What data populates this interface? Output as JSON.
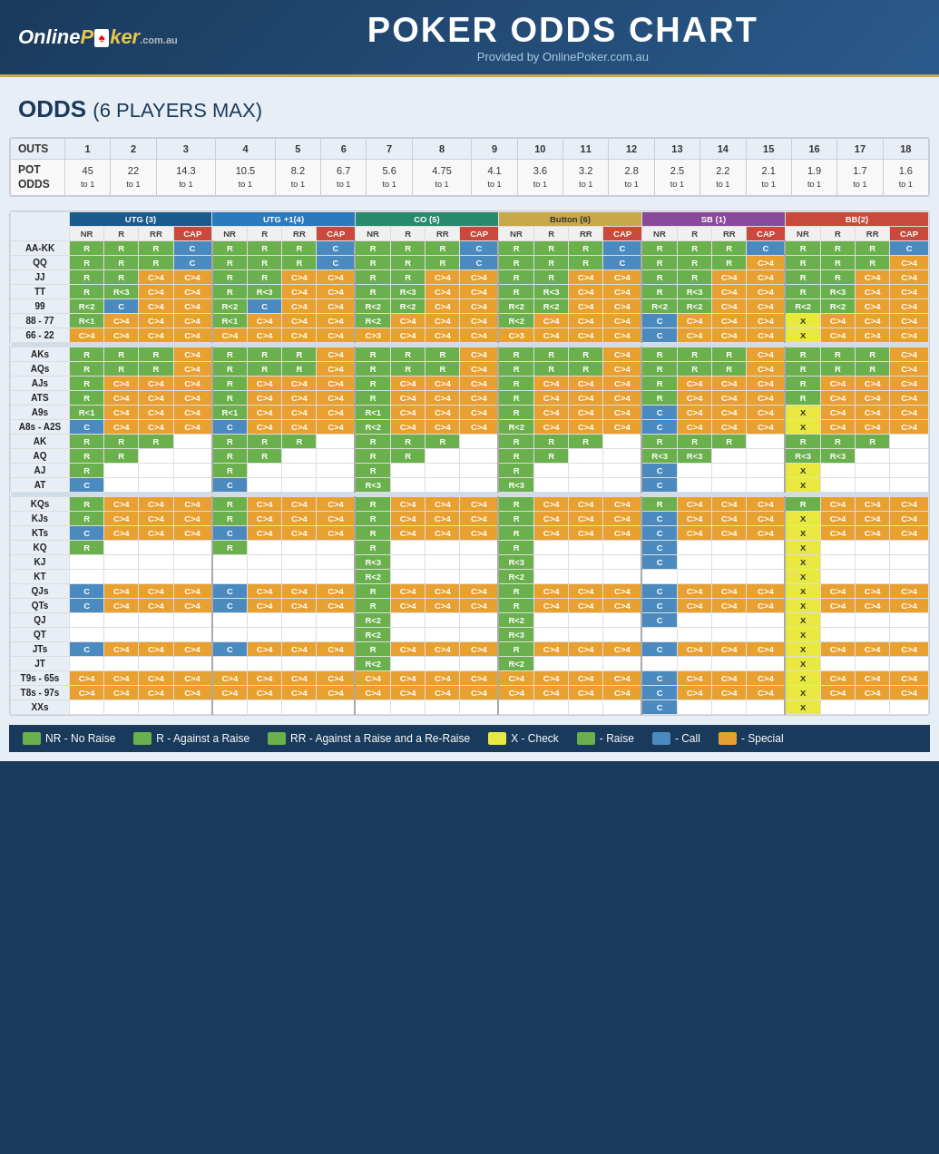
{
  "header": {
    "logo": "OnlinePoker.com.au",
    "title": "POKER ODDS CHART",
    "subtitle": "Provided by OnlinePoker.com.au"
  },
  "section_title": "ODDS",
  "section_subtitle": "(6 PLAYERS MAX)",
  "outs_row": {
    "label": "OUTS",
    "values": [
      "1",
      "2",
      "3",
      "4",
      "5",
      "6",
      "7",
      "8",
      "9",
      "10",
      "11",
      "12",
      "13",
      "14",
      "15",
      "16",
      "17",
      "18"
    ]
  },
  "pot_odds_row": {
    "label1": "POT",
    "label2": "ODDS",
    "values": [
      {
        "top": "45",
        "bot": "to 1"
      },
      {
        "top": "22",
        "bot": "to 1"
      },
      {
        "top": "14.3",
        "bot": "to 1"
      },
      {
        "top": "10.5",
        "bot": "to 1"
      },
      {
        "top": "8.2",
        "bot": "to 1"
      },
      {
        "top": "6.7",
        "bot": "to 1"
      },
      {
        "top": "5.6",
        "bot": "to 1"
      },
      {
        "top": "4.75",
        "bot": "to 1"
      },
      {
        "top": "4.1",
        "bot": "to 1"
      },
      {
        "top": "3.6",
        "bot": "to 1"
      },
      {
        "top": "3.2",
        "bot": "to 1"
      },
      {
        "top": "2.8",
        "bot": "to 1"
      },
      {
        "top": "2.5",
        "bot": "to 1"
      },
      {
        "top": "2.2",
        "bot": "to 1"
      },
      {
        "top": "2.1",
        "bot": "to 1"
      },
      {
        "top": "1.9",
        "bot": "to 1"
      },
      {
        "top": "1.7",
        "bot": "to 1"
      },
      {
        "top": "1.6",
        "bot": "to 1"
      }
    ]
  },
  "positions": [
    {
      "name": "UTG (3)",
      "key": "utg"
    },
    {
      "name": "UTG +1(4)",
      "key": "utg1"
    },
    {
      "name": "CO (5)",
      "key": "co"
    },
    {
      "name": "Button (6)",
      "key": "btn"
    },
    {
      "name": "SB (1)",
      "key": "sb"
    },
    {
      "name": "BB(2)",
      "key": "bb"
    }
  ],
  "sub_headers": [
    "NR",
    "R",
    "RR",
    "CAP"
  ],
  "legend": {
    "nr": "NR - No Raise",
    "r": "R - Against a Raise",
    "rr": "RR - Against a Raise and a Re-Raise",
    "x": "X - Check",
    "raise_label": "- Raise",
    "call_label": "- Call",
    "special_label": "- Special",
    "colors": {
      "nr_bg": "#6ab04c",
      "r_bg": "#6ab04c",
      "rr_bg": "#6ab04c",
      "call_bg": "#4a8abf",
      "x_bg": "#e8e840",
      "raise_bg": "#6ab04c",
      "special_bg": "#e8a030"
    }
  },
  "hands": [
    {
      "hand": "AA-KK",
      "rows": [
        [
          "R",
          "R",
          "R",
          "C",
          "R",
          "R",
          "R",
          "C",
          "R",
          "R",
          "R",
          "C",
          "R",
          "R",
          "R",
          "C",
          "R",
          "R",
          "R",
          "C",
          "R",
          "R",
          "R",
          "C"
        ]
      ]
    },
    {
      "hand": "QQ",
      "rows": [
        [
          "R",
          "R",
          "R",
          "C",
          "R",
          "R",
          "R",
          "C",
          "R",
          "R",
          "R",
          "C",
          "R",
          "R",
          "R",
          "C",
          "R",
          "R",
          "R",
          "C>4",
          "R",
          "R",
          "R",
          "C>4"
        ]
      ]
    },
    {
      "hand": "JJ",
      "rows": [
        [
          "R",
          "R",
          "C>4",
          "C>4",
          "R",
          "R",
          "C>4",
          "C>4",
          "R",
          "R",
          "C>4",
          "C>4",
          "R",
          "R",
          "C>4",
          "C>4",
          "R",
          "R",
          "C>4",
          "C>4",
          "R",
          "R",
          "C>4",
          "C>4"
        ]
      ]
    },
    {
      "hand": "TT",
      "rows": [
        [
          "R",
          "R<3",
          "C>4",
          "C>4",
          "R",
          "R<3",
          "C>4",
          "C>4",
          "R",
          "R<3",
          "C>4",
          "C>4",
          "R",
          "R<3",
          "C>4",
          "C>4",
          "R",
          "R<3",
          "C>4",
          "C>4",
          "R",
          "R<3",
          "C>4",
          "C>4"
        ]
      ]
    },
    {
      "hand": "99",
      "rows": [
        [
          "R<2",
          "C",
          "C>4",
          "C>4",
          "R<2",
          "C",
          "C>4",
          "C>4",
          "R<2",
          "R<2",
          "C>4",
          "C>4",
          "R<2",
          "R<2",
          "C>4",
          "C>4",
          "R<2",
          "R<2",
          "C>4",
          "C>4",
          "R<2",
          "R<2",
          "C>4",
          "C>4"
        ]
      ]
    },
    {
      "hand": "88 - 77",
      "rows": [
        [
          "R<1",
          "C>4",
          "C>4",
          "C>4",
          "R<1",
          "C>4",
          "C>4",
          "C>4",
          "R<2",
          "C>4",
          "C>4",
          "C>4",
          "R<2",
          "C>4",
          "C>4",
          "C>4",
          "C",
          "C>4",
          "C>4",
          "C>4",
          "X",
          "C>4",
          "C>4",
          "C>4"
        ]
      ]
    },
    {
      "hand": "66 - 22",
      "rows": [
        [
          "C>4",
          "C>4",
          "C>4",
          "C>4",
          "C>4",
          "C>4",
          "C>4",
          "C>4",
          "C>3",
          "C>4",
          "C>4",
          "C>4",
          "C>3",
          "C>4",
          "C>4",
          "C>4",
          "C",
          "C>4",
          "C>4",
          "C>4",
          "X",
          "C>4",
          "C>4",
          "C>4"
        ]
      ]
    },
    {
      "hand": "AKs",
      "rows": [
        [
          "R",
          "R",
          "R",
          "C>4",
          "R",
          "R",
          "R",
          "C>4",
          "R",
          "R",
          "R",
          "C>4",
          "R",
          "R",
          "R",
          "C>4",
          "R",
          "R",
          "R",
          "C>4",
          "R",
          "R",
          "R",
          "C>4"
        ]
      ]
    },
    {
      "hand": "AQs",
      "rows": [
        [
          "R",
          "R",
          "R",
          "C>4",
          "R",
          "R",
          "R",
          "C>4",
          "R",
          "R",
          "R",
          "C>4",
          "R",
          "R",
          "R",
          "C>4",
          "R",
          "R",
          "R",
          "C>4",
          "R",
          "R",
          "R",
          "C>4"
        ]
      ]
    },
    {
      "hand": "AJs",
      "rows": [
        [
          "R",
          "C>4",
          "C>4",
          "C>4",
          "R",
          "C>4",
          "C>4",
          "C>4",
          "R",
          "C>4",
          "C>4",
          "C>4",
          "R",
          "C>4",
          "C>4",
          "C>4",
          "R",
          "C>4",
          "C>4",
          "C>4",
          "R",
          "C>4",
          "C>4",
          "C>4"
        ]
      ]
    },
    {
      "hand": "ATS",
      "rows": [
        [
          "R",
          "C>4",
          "C>4",
          "C>4",
          "R",
          "C>4",
          "C>4",
          "C>4",
          "R",
          "C>4",
          "C>4",
          "C>4",
          "R",
          "C>4",
          "C>4",
          "C>4",
          "R",
          "C>4",
          "C>4",
          "C>4",
          "R",
          "C>4",
          "C>4",
          "C>4"
        ]
      ]
    },
    {
      "hand": "A9s",
      "rows": [
        [
          "R<1",
          "C>4",
          "C>4",
          "C>4",
          "R<1",
          "C>4",
          "C>4",
          "C>4",
          "R<1",
          "C>4",
          "C>4",
          "C>4",
          "R",
          "C>4",
          "C>4",
          "C>4",
          "C",
          "C>4",
          "C>4",
          "C>4",
          "X",
          "C>4",
          "C>4",
          "C>4"
        ]
      ]
    },
    {
      "hand": "A8s - A2S",
      "rows": [
        [
          "C",
          "C>4",
          "C>4",
          "C>4",
          "C",
          "C>4",
          "C>4",
          "C>4",
          "R<2",
          "C>4",
          "C>4",
          "C>4",
          "R<2",
          "C>4",
          "C>4",
          "C>4",
          "C",
          "C>4",
          "C>4",
          "C>4",
          "X",
          "C>4",
          "C>4",
          "C>4"
        ]
      ]
    },
    {
      "hand": "AK",
      "rows": [
        [
          "R",
          "R",
          "R",
          "",
          "R",
          "R",
          "R",
          "",
          "R",
          "R",
          "R",
          "",
          "R",
          "R",
          "R",
          "",
          "R",
          "R",
          "R",
          "",
          "R",
          "R",
          "R",
          ""
        ]
      ]
    },
    {
      "hand": "AQ",
      "rows": [
        [
          "R",
          "R",
          "",
          "",
          "R",
          "R",
          "",
          "",
          "R",
          "R",
          "",
          "",
          "R",
          "R",
          "",
          "",
          "R<3",
          "R<3",
          "",
          "",
          "R<3",
          "R<3",
          "",
          ""
        ]
      ]
    },
    {
      "hand": "AJ",
      "rows": [
        [
          "R",
          "",
          "",
          "",
          "R",
          "",
          "",
          "",
          "R",
          "",
          "",
          "",
          "R",
          "",
          "",
          "",
          "C",
          "",
          "",
          "",
          "X",
          "",
          "",
          ""
        ]
      ]
    },
    {
      "hand": "AT",
      "rows": [
        [
          "C",
          "",
          "",
          "",
          "C",
          "",
          "",
          "",
          "R<3",
          "",
          "",
          "",
          "R<3",
          "",
          "",
          "",
          "C",
          "",
          "",
          "",
          "X",
          "",
          "",
          ""
        ]
      ]
    },
    {
      "hand": "KQs",
      "rows": [
        [
          "R",
          "C>4",
          "C>4",
          "C>4",
          "R",
          "C>4",
          "C>4",
          "C>4",
          "R",
          "C>4",
          "C>4",
          "C>4",
          "R",
          "C>4",
          "C>4",
          "C>4",
          "R",
          "C>4",
          "C>4",
          "C>4",
          "R",
          "C>4",
          "C>4",
          "C>4"
        ]
      ]
    },
    {
      "hand": "KJs",
      "rows": [
        [
          "R",
          "C>4",
          "C>4",
          "C>4",
          "R",
          "C>4",
          "C>4",
          "C>4",
          "R",
          "C>4",
          "C>4",
          "C>4",
          "R",
          "C>4",
          "C>4",
          "C>4",
          "C",
          "C>4",
          "C>4",
          "C>4",
          "X",
          "C>4",
          "C>4",
          "C>4"
        ]
      ]
    },
    {
      "hand": "KTs",
      "rows": [
        [
          "C",
          "C>4",
          "C>4",
          "C>4",
          "C",
          "C>4",
          "C>4",
          "C>4",
          "R",
          "C>4",
          "C>4",
          "C>4",
          "R",
          "C>4",
          "C>4",
          "C>4",
          "C",
          "C>4",
          "C>4",
          "C>4",
          "X",
          "C>4",
          "C>4",
          "C>4"
        ]
      ]
    },
    {
      "hand": "KQ",
      "rows": [
        [
          "R",
          "",
          "",
          "",
          "R",
          "",
          "",
          "",
          "R",
          "",
          "",
          "",
          "R",
          "",
          "",
          "",
          "C",
          "",
          "",
          "",
          "X",
          "",
          "",
          ""
        ]
      ]
    },
    {
      "hand": "KJ",
      "rows": [
        [
          "",
          "",
          "",
          "",
          "",
          "",
          "",
          "",
          "R<3",
          "",
          "",
          "",
          "R<3",
          "",
          "",
          "",
          "C",
          "",
          "",
          "",
          "X",
          "",
          "",
          ""
        ]
      ]
    },
    {
      "hand": "KT",
      "rows": [
        [
          "",
          "",
          "",
          "",
          "",
          "",
          "",
          "",
          "R<2",
          "",
          "",
          "",
          "R<2",
          "",
          "",
          "",
          "",
          "",
          "",
          "",
          "X",
          "",
          "",
          ""
        ]
      ]
    },
    {
      "hand": "QJs",
      "rows": [
        [
          "C",
          "C>4",
          "C>4",
          "C>4",
          "C",
          "C>4",
          "C>4",
          "C>4",
          "R",
          "C>4",
          "C>4",
          "C>4",
          "R",
          "C>4",
          "C>4",
          "C>4",
          "C",
          "C>4",
          "C>4",
          "C>4",
          "X",
          "C>4",
          "C>4",
          "C>4"
        ]
      ]
    },
    {
      "hand": "QTs",
      "rows": [
        [
          "C",
          "C>4",
          "C>4",
          "C>4",
          "C",
          "C>4",
          "C>4",
          "C>4",
          "R",
          "C>4",
          "C>4",
          "C>4",
          "R",
          "C>4",
          "C>4",
          "C>4",
          "C",
          "C>4",
          "C>4",
          "C>4",
          "X",
          "C>4",
          "C>4",
          "C>4"
        ]
      ]
    },
    {
      "hand": "QJ",
      "rows": [
        [
          "",
          "",
          "",
          "",
          "",
          "",
          "",
          "",
          "R<2",
          "",
          "",
          "",
          "R<2",
          "",
          "",
          "",
          "C",
          "",
          "",
          "",
          "X",
          "",
          "",
          ""
        ]
      ]
    },
    {
      "hand": "QT",
      "rows": [
        [
          "",
          "",
          "",
          "",
          "",
          "",
          "",
          "",
          "R<2",
          "",
          "",
          "",
          "R<3",
          "",
          "",
          "",
          "",
          "",
          "",
          "",
          "X",
          "",
          "",
          ""
        ]
      ]
    },
    {
      "hand": "JTs",
      "rows": [
        [
          "C",
          "C>4",
          "C>4",
          "C>4",
          "C",
          "C>4",
          "C>4",
          "C>4",
          "R",
          "C>4",
          "C>4",
          "C>4",
          "R",
          "C>4",
          "C>4",
          "C>4",
          "C",
          "C>4",
          "C>4",
          "C>4",
          "X",
          "C>4",
          "C>4",
          "C>4"
        ]
      ]
    },
    {
      "hand": "JT",
      "rows": [
        [
          "",
          "",
          "",
          "",
          "",
          "",
          "",
          "",
          "R<2",
          "",
          "",
          "",
          "R<2",
          "",
          "",
          "",
          "",
          "",
          "",
          "",
          "X",
          "",
          "",
          ""
        ]
      ]
    },
    {
      "hand": "T9s - 65s",
      "rows": [
        [
          "C>4",
          "C>4",
          "C>4",
          "C>4",
          "C>4",
          "C>4",
          "C>4",
          "C>4",
          "C>4",
          "C>4",
          "C>4",
          "C>4",
          "C>4",
          "C>4",
          "C>4",
          "C>4",
          "C",
          "C>4",
          "C>4",
          "C>4",
          "X",
          "C>4",
          "C>4",
          "C>4"
        ]
      ]
    },
    {
      "hand": "T8s - 97s",
      "rows": [
        [
          "C>4",
          "C>4",
          "C>4",
          "C>4",
          "C>4",
          "C>4",
          "C>4",
          "C>4",
          "C>4",
          "C>4",
          "C>4",
          "C>4",
          "C>4",
          "C>4",
          "C>4",
          "C>4",
          "C",
          "C>4",
          "C>4",
          "C>4",
          "X",
          "C>4",
          "C>4",
          "C>4"
        ]
      ]
    },
    {
      "hand": "XXs",
      "rows": [
        [
          "",
          "",
          "",
          "",
          "",
          "",
          "",
          "",
          "",
          "",
          "",
          "",
          "",
          "",
          "",
          "",
          "C",
          "",
          "",
          "",
          "X",
          "",
          "",
          ""
        ]
      ]
    }
  ]
}
